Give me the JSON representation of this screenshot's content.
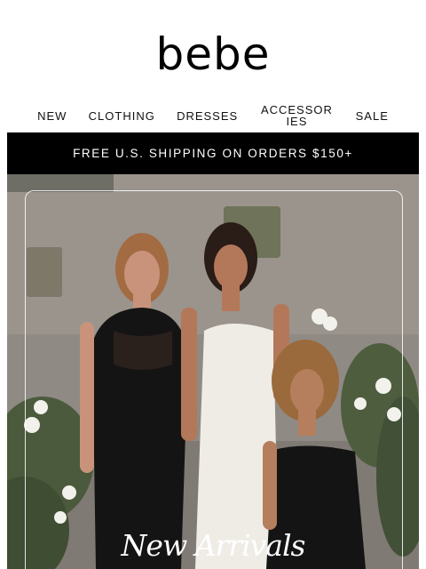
{
  "brand": {
    "logo_text": "bebe"
  },
  "nav": {
    "new": "NEW",
    "clothing": "CLOTHING",
    "dresses": "DRESSES",
    "accessories": "ACCESSORIES",
    "sale": "SALE"
  },
  "promo": {
    "shipping_text": "FREE U.S. SHIPPING ON ORDERS $150+"
  },
  "hero": {
    "title": "New Arrivals",
    "image_alt_icon": "hero-photo",
    "colors": {
      "wall": "#8f8a84",
      "dress_black": "#141414",
      "dress_white": "#efece6",
      "foliage": "#4b5a3c",
      "flowers": "#f2f1ec"
    }
  }
}
